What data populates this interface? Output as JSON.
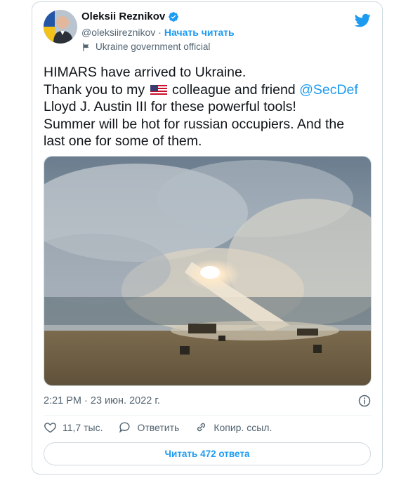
{
  "tweet": {
    "author_name": "Oleksii Reznikov",
    "handle": "@oleksiireznikov",
    "separator": "·",
    "follow_label": "Начать читать",
    "account_label": "Ukraine government official",
    "text_lines": [
      "HIMARS have arrived to Ukraine.",
      "Thank you to my",
      "colleague and friend",
      "@SecDef",
      "Lloyd J. Austin III for these powerful tools!",
      "Summer will be hot for russian occupiers. And the",
      "last one for some of them."
    ],
    "timestamp": "2:21 PM · 23 июн. 2022 г.",
    "likes": "11,7 тыс.",
    "reply_label": "Ответить",
    "copy_link_label": "Копир. ссыл.",
    "read_replies_label": "Читать 472 ответа"
  },
  "colors": {
    "accent": "#1d9bf0",
    "secondary_text": "#536471",
    "border": "#cfd9de"
  },
  "icons": {
    "verified": "verified-badge-icon",
    "brand": "twitter-bird-icon",
    "label": "flag-icon",
    "like": "heart-icon",
    "reply": "speech-bubble-icon",
    "copy": "link-icon",
    "info": "info-icon"
  }
}
